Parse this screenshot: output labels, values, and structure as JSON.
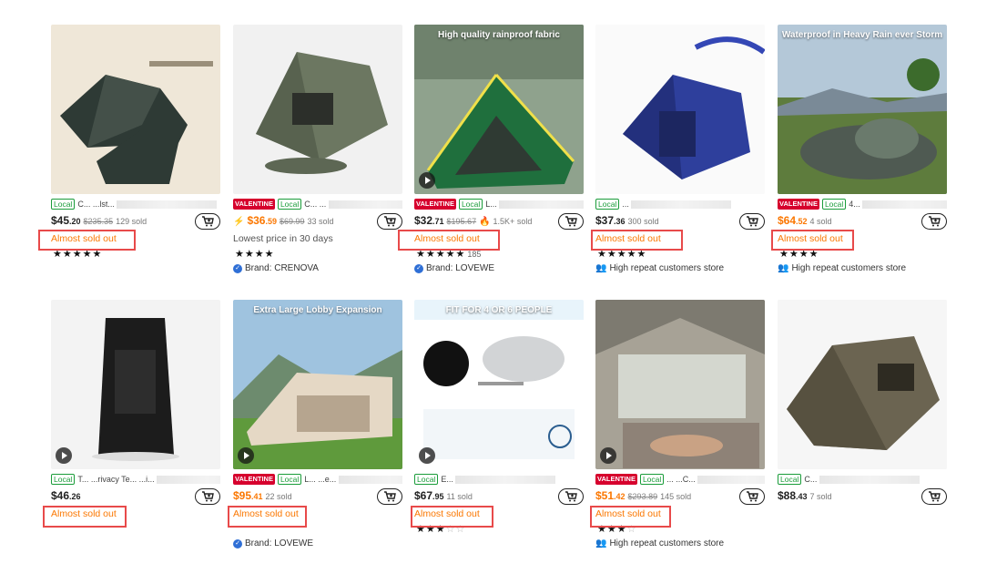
{
  "products": [
    {
      "image_text": "",
      "valentine": false,
      "local": "Local",
      "title": "C... ...lst...",
      "price": "$45",
      "price_dec": ".20",
      "price_color": "dark",
      "orig": "$235.35",
      "sold": "129 sold",
      "flame": false,
      "line2": "Almost sold out",
      "line2_type": "almost",
      "stars": "★★★★★",
      "stars_gray": "",
      "count": "",
      "brand": "",
      "brand_type": ""
    },
    {
      "image_text": "",
      "valentine": true,
      "local": "Local",
      "title": "C... ...",
      "price": "$36",
      "price_dec": ".59",
      "price_color": "orange",
      "orig": "$69.99",
      "sold": "33 sold",
      "flame": true,
      "line2": "Lowest price in 30 days",
      "line2_type": "plain",
      "stars": "★★★★",
      "stars_gray": "",
      "count": "",
      "brand": "Brand: CRENOVA",
      "brand_type": "brand"
    },
    {
      "image_text": "High quality rainproof fabric",
      "valentine": true,
      "local": "Local",
      "title": "L...",
      "price": "$32",
      "price_dec": ".71",
      "price_color": "dark",
      "orig": "$195.67",
      "sold": "1.5K+ sold",
      "flame": true,
      "line2": "Almost sold out",
      "line2_type": "almost",
      "stars": "★★★★★",
      "stars_gray": "",
      "count": "185",
      "brand": "Brand: LOVEWE",
      "brand_type": "brand"
    },
    {
      "image_text": "",
      "valentine": false,
      "local": "Local",
      "title": "...",
      "price": "$37",
      "price_dec": ".36",
      "price_color": "dark",
      "orig": "",
      "sold": "300 sold",
      "flame": false,
      "line2": "Almost sold out",
      "line2_type": "almost",
      "stars": "★★★★★",
      "stars_gray": "",
      "count": "",
      "brand": "High repeat customers store",
      "brand_type": "people"
    },
    {
      "image_text": "Waterproof in Heavy Rain ever Storm",
      "valentine": true,
      "local": "Local",
      "title": "4...",
      "price": "$64",
      "price_dec": ".52",
      "price_color": "orange",
      "orig": "",
      "sold": "4 sold",
      "flame": false,
      "line2": "Almost sold out",
      "line2_type": "almost",
      "stars": "★★★★",
      "stars_gray": "",
      "count": "",
      "brand": "High repeat customers store",
      "brand_type": "people"
    },
    {
      "image_text": "",
      "valentine": false,
      "local": "Local",
      "title": "T... ...rivacy Te... ...i...",
      "price": "$46",
      "price_dec": ".26",
      "price_color": "dark",
      "orig": "",
      "sold": "",
      "flame": false,
      "line2": "Almost sold out",
      "line2_type": "almost",
      "stars": "",
      "stars_gray": "",
      "count": "",
      "brand": "",
      "brand_type": ""
    },
    {
      "image_text": "Extra Large Lobby Expansion",
      "valentine": true,
      "local": "Local",
      "title": "L... ...e...",
      "price": "$95",
      "price_dec": ".41",
      "price_color": "orange",
      "orig": "",
      "sold": "22 sold",
      "flame": false,
      "line2": "Almost sold out",
      "line2_type": "almost",
      "stars": "",
      "stars_gray": "",
      "count": "",
      "brand": "Brand: LOVEWE",
      "brand_type": "brand"
    },
    {
      "image_text": "FIT FOR 4 OR 6 PEOPLE",
      "valentine": false,
      "local": "Local",
      "title": "E...",
      "price": "$67",
      "price_dec": ".95",
      "price_color": "dark",
      "orig": "",
      "sold": "11 sold",
      "flame": false,
      "line2": "Almost sold out",
      "line2_type": "almost",
      "stars": "★★★",
      "stars_gray": "☆☆",
      "count": "",
      "brand": "",
      "brand_type": ""
    },
    {
      "image_text": "",
      "valentine": true,
      "local": "Local",
      "title": "... ...C...",
      "price": "$51",
      "price_dec": ".42",
      "price_color": "orange",
      "orig": "$293.89",
      "sold": "145 sold",
      "flame": false,
      "line2": "Almost sold out",
      "line2_type": "almost",
      "stars": "★★★",
      "stars_gray": "☆",
      "count": "",
      "brand": "High repeat customers store",
      "brand_type": "people"
    },
    {
      "image_text": "",
      "valentine": false,
      "local": "Local",
      "title": "C...",
      "price": "$88",
      "price_dec": ".43",
      "price_color": "dark",
      "orig": "",
      "sold": "7 sold",
      "flame": false,
      "line2": "",
      "line2_type": "",
      "stars": "",
      "stars_gray": "",
      "count": "",
      "brand": "",
      "brand_type": ""
    }
  ],
  "colors": {
    "accent": "#fb7701",
    "valentine": "#d6002d",
    "local": "#1a9c3a",
    "highlight_box": "#e84a4a"
  },
  "icons": {
    "cart": "add-to-cart-icon",
    "play": "play-icon",
    "verified": "verified-check-icon",
    "people": "people-icon"
  }
}
